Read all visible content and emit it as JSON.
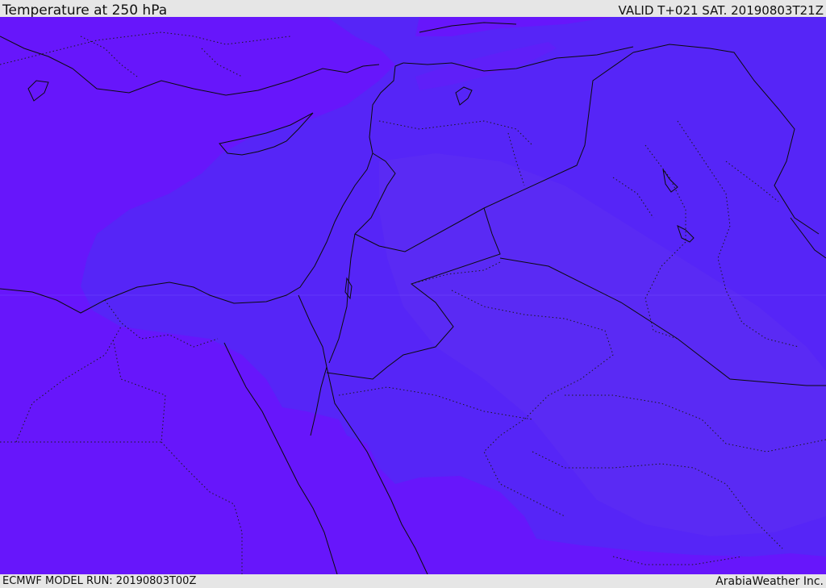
{
  "header": {
    "title": "Temperature at 250 hPa",
    "valid": "VALID T+021 SAT. 20190803T21Z"
  },
  "footer": {
    "model_run": "ECMWF MODEL RUN: 20190803T00Z",
    "brand": "ArabiaWeather Inc."
  },
  "colors": {
    "cold_fill": "#6716fb",
    "mid_fill": "#5625f7",
    "warm_fill": "#5a28f5",
    "border": "#0b0b0b",
    "header_bg": "#e6e6e6"
  }
}
